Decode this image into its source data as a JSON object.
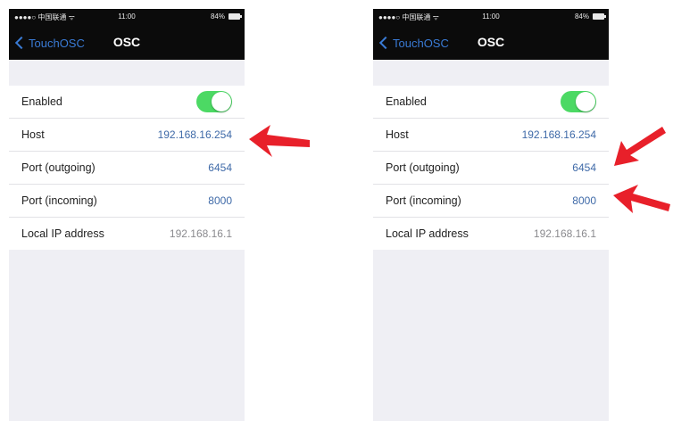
{
  "statusbar": {
    "carrier": "●●●●○ 中国联通 ᯤ",
    "time": "11:00",
    "battery": "84%"
  },
  "navbar": {
    "back_label": "TouchOSC",
    "title": "OSC"
  },
  "settings": {
    "enabled_label": "Enabled",
    "enabled_value": true,
    "host_label": "Host",
    "host_value": "192.168.16.254",
    "port_out_label": "Port (outgoing)",
    "port_out_value": "6454",
    "port_in_label": "Port (incoming)",
    "port_in_value": "8000",
    "local_ip_label": "Local IP address",
    "local_ip_value": "192.168.16.1"
  },
  "colors": {
    "accent": "#3a7bd5",
    "toggle_on": "#4cd964",
    "annotation_arrow": "#e8202a"
  },
  "annotations": {
    "left_screen_arrows": [
      "host"
    ],
    "right_screen_arrows": [
      "port_outgoing",
      "port_incoming"
    ]
  }
}
